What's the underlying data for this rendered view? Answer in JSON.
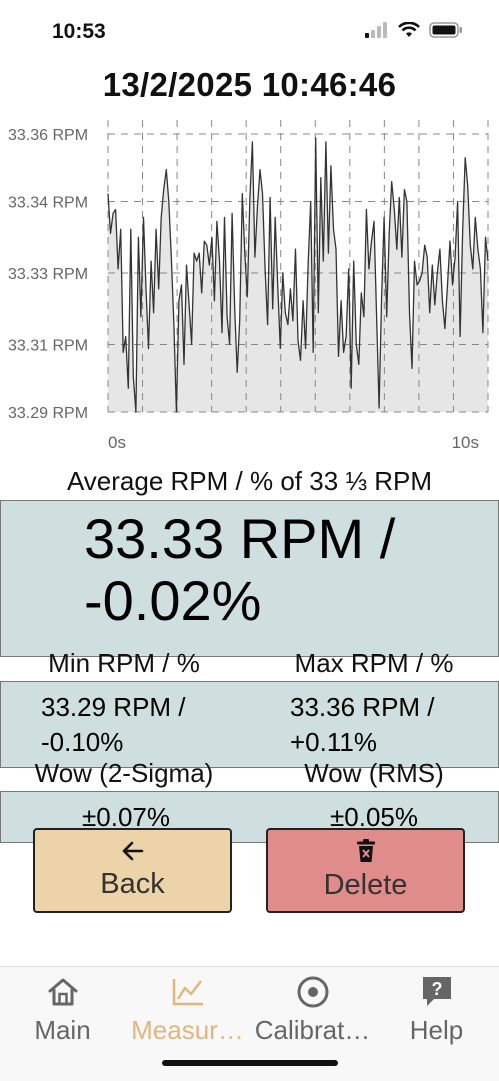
{
  "status": {
    "time": "10:53"
  },
  "title": "13/2/2025 10:46:46",
  "chart_data": {
    "type": "area",
    "ylim": [
      33.29,
      33.36
    ],
    "y_ticks": [
      "33.36 RPM",
      "33.34 RPM",
      "33.33 RPM",
      "33.31 RPM",
      "33.29 RPM"
    ],
    "y_tick_values": [
      33.36,
      33.343,
      33.325,
      33.307,
      33.29
    ],
    "x_ticks": [
      "0s",
      "10s"
    ],
    "xlim": [
      0,
      10
    ],
    "grid": true,
    "colors": {
      "fill": "#e6e6e6",
      "line": "#333333"
    },
    "series": [
      {
        "values": [
          33.345,
          33.335,
          33.34,
          33.341,
          33.326,
          33.336,
          33.305,
          33.309,
          33.296,
          33.336,
          33.299,
          33.29,
          33.334,
          33.314,
          33.339,
          33.321,
          33.306,
          33.328,
          33.315,
          33.336,
          33.321,
          33.339,
          33.346,
          33.351,
          33.343,
          33.329,
          33.312,
          33.29,
          33.318,
          33.322,
          33.302,
          33.327,
          33.317,
          33.307,
          33.33,
          33.328,
          33.33,
          33.32,
          33.333,
          33.332,
          33.327,
          33.334,
          33.318,
          33.338,
          33.328,
          33.31,
          33.339,
          33.314,
          33.307,
          33.34,
          33.316,
          33.3,
          33.313,
          33.345,
          33.33,
          33.319,
          33.344,
          33.358,
          33.329,
          33.342,
          33.351,
          33.345,
          33.326,
          33.312,
          33.344,
          33.316,
          33.339,
          33.322,
          33.306,
          33.325,
          33.315,
          33.312,
          33.321,
          33.313,
          33.331,
          33.308,
          33.303,
          33.318,
          33.306,
          33.327,
          33.343,
          33.305,
          33.359,
          33.315,
          33.349,
          33.328,
          33.358,
          33.33,
          33.352,
          33.336,
          33.331,
          33.304,
          33.318,
          33.305,
          33.309,
          33.326,
          33.296,
          33.328,
          33.307,
          33.302,
          33.32,
          33.314,
          33.341,
          33.326,
          33.333,
          33.338,
          33.315,
          33.291,
          33.319,
          33.339,
          33.314,
          33.335,
          33.348,
          33.341,
          33.331,
          33.344,
          33.329,
          33.346,
          33.343,
          33.315,
          33.301,
          33.328,
          33.322,
          33.323,
          33.325,
          33.332,
          33.329,
          33.315,
          33.327,
          33.317,
          33.325,
          33.331,
          33.318,
          33.311,
          33.322,
          33.333,
          33.322,
          33.329,
          33.343,
          33.309,
          33.336,
          33.354,
          33.347,
          33.332,
          33.326,
          33.339,
          33.331,
          33.326,
          33.31,
          33.334,
          33.328
        ]
      }
    ]
  },
  "average": {
    "label": "Average RPM / % of 33 ⅓ RPM",
    "value_line1": "33.33 RPM /",
    "value_line2": "-0.02%"
  },
  "min": {
    "label": "Min RPM / %",
    "value_line1": "33.29 RPM /",
    "value_line2": "-0.10%"
  },
  "max": {
    "label": "Max RPM / %",
    "value_line1": "33.36 RPM /",
    "value_line2": "+0.11%"
  },
  "wow_2sigma": {
    "label": "Wow (2-Sigma)",
    "value": "±0.07%"
  },
  "wow_rms": {
    "label": "Wow (RMS)",
    "value": "±0.05%"
  },
  "buttons": {
    "back": "Back",
    "delete": "Delete"
  },
  "tabs": [
    {
      "label": "Main",
      "icon": "home-icon"
    },
    {
      "label": "Measur…",
      "icon": "chart-line-icon",
      "active": true
    },
    {
      "label": "Calibrat…",
      "icon": "target-icon"
    },
    {
      "label": "Help",
      "icon": "help-icon"
    }
  ],
  "colors": {
    "accent": "#e2b67c",
    "box_bg": "#cfdfdf",
    "back_bg": "#ecd3a8",
    "delete_bg": "#e08c8a"
  }
}
